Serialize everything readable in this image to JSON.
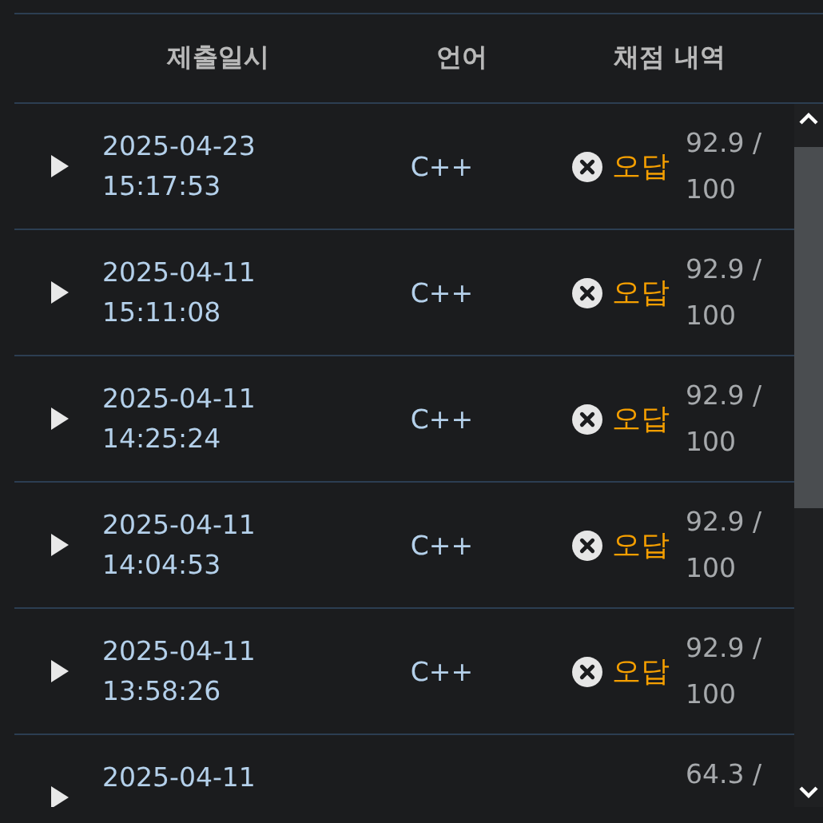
{
  "columns": [
    "제출일시",
    "언어",
    "채점 내역"
  ],
  "rows": [
    {
      "date": "2025-04-23",
      "time": "15:17:53",
      "language": "C++",
      "verdict": {
        "kind": "wrong",
        "label": "오답"
      },
      "score": "92.9 / 100"
    },
    {
      "date": "2025-04-11",
      "time": "15:11:08",
      "language": "C++",
      "verdict": {
        "kind": "wrong",
        "label": "오답"
      },
      "score": "92.9 / 100"
    },
    {
      "date": "2025-04-11",
      "time": "14:25:24",
      "language": "C++",
      "verdict": {
        "kind": "wrong",
        "label": "오답"
      },
      "score": "92.9 / 100"
    },
    {
      "date": "2025-04-11",
      "time": "14:04:53",
      "language": "C++",
      "verdict": {
        "kind": "wrong",
        "label": "오답"
      },
      "score": "92.9 / 100"
    },
    {
      "date": "2025-04-11",
      "time": "13:58:26",
      "language": "C++",
      "verdict": {
        "kind": "wrong",
        "label": "오답"
      },
      "score": "92.9 / 100"
    },
    {
      "date": "2025-04-11",
      "score": "64.3 /"
    }
  ]
}
